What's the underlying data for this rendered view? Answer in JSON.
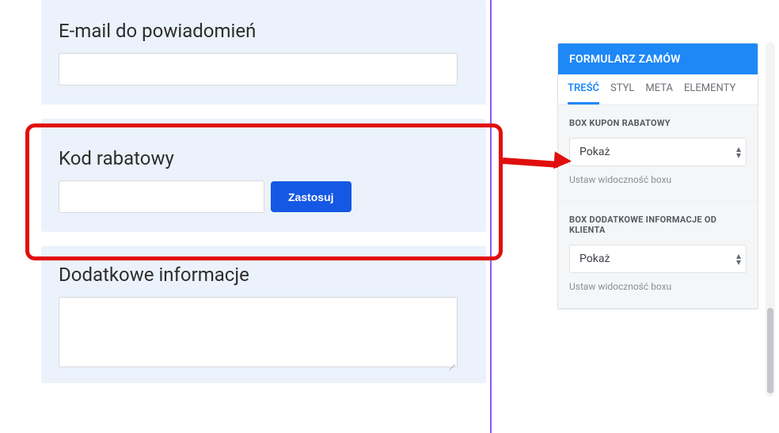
{
  "form": {
    "email_section": {
      "label": "E-mail do powiadomień"
    },
    "coupon_section": {
      "label": "Kod rabatowy",
      "apply_button": "Zastosuj"
    },
    "notes_section": {
      "label": "Dodatkowe informacje"
    }
  },
  "sidebar": {
    "title": "FORMULARZ ZAMÓW",
    "tabs": [
      {
        "label": "TREŚĆ",
        "active": true
      },
      {
        "label": "STYL"
      },
      {
        "label": "META"
      },
      {
        "label": "ELEMENTY"
      }
    ],
    "panel_coupon": {
      "title": "BOX KUPON RABATOWY",
      "select_value": "Pokaż",
      "hint": "Ustaw widoczność boxu"
    },
    "panel_extra": {
      "title": "BOX DODATKOWE INFORMACJE OD KLIENTA",
      "select_value": "Pokaż",
      "hint": "Ustaw widoczność boxu"
    }
  }
}
